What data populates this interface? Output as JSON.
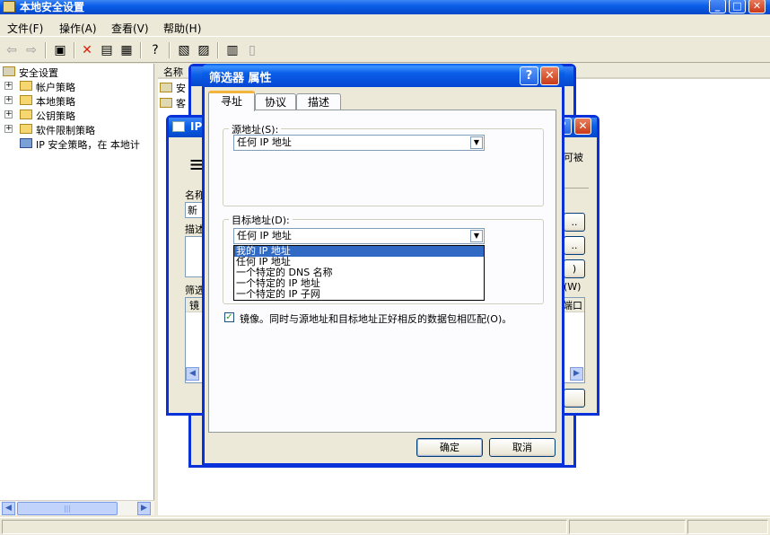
{
  "main_window": {
    "title": "本地安全设置",
    "menu": [
      "文件(F)",
      "操作(A)",
      "查看(V)",
      "帮助(H)"
    ]
  },
  "tree": {
    "items": [
      {
        "label": "安全设置",
        "expandable": false
      },
      {
        "label": "帐户策略",
        "expandable": true
      },
      {
        "label": "本地策略",
        "expandable": true
      },
      {
        "label": "公钥策略",
        "expandable": true
      },
      {
        "label": "软件限制策略",
        "expandable": true
      },
      {
        "label": "IP 安全策略，在 本地计",
        "expandable": false
      }
    ]
  },
  "right_pane": {
    "column_header": "名称",
    "rows": [
      "安",
      "客",
      ""
    ]
  },
  "ip_dialog": {
    "title": "IP",
    "labels": {
      "name": "名称",
      "name_value": "新",
      "desc": "描述",
      "filter": "筛选",
      "mirror_col": "镜",
      "side_text": "可被",
      "side_w": "(W)",
      "port_col": "端口"
    }
  },
  "filter_dialog": {
    "title": "筛选器 属性",
    "tabs": [
      "寻址",
      "协议",
      "描述"
    ],
    "source": {
      "label": "源地址(S):",
      "value": "任何 IP 地址"
    },
    "destination": {
      "label": "目标地址(D):",
      "value": "任何 IP 地址",
      "options": [
        "我的 IP 地址",
        "任何 IP 地址",
        "一个特定的 DNS 名称",
        "一个特定的 IP 地址",
        "一个特定的 IP 子网"
      ],
      "highlighted_index": 0
    },
    "mirror": {
      "checked": true,
      "label": "镜像。同时与源地址和目标地址正好相反的数据包相匹配(O)。"
    },
    "ok_label": "确定",
    "cancel_label": "取消"
  },
  "colors": {
    "titlebar_blue": "#0a5ee8",
    "highlight": "#316ac5",
    "face": "#ece9d8"
  }
}
